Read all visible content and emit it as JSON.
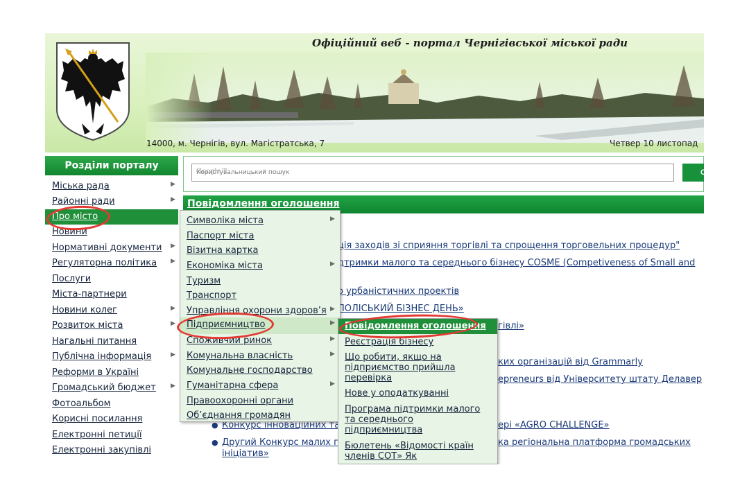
{
  "header": {
    "site_title": "Офіційний веб - портал Чернігівської міської ради",
    "address": "14000, м. Чернігів, вул. Магістратська, 7",
    "date": "Четвер 10 листопад"
  },
  "sidebar": {
    "title": "Розділи порталу",
    "items": [
      {
        "label": "Міська рада",
        "has_submenu": true
      },
      {
        "label": "Районні ради",
        "has_submenu": true
      },
      {
        "label": "Про місто",
        "has_submenu": false,
        "active": true
      },
      {
        "label": "Новини",
        "has_submenu": false
      },
      {
        "label": "Нормативні документи",
        "has_submenu": true
      },
      {
        "label": "Регуляторна політика",
        "has_submenu": true
      },
      {
        "label": "Послуги",
        "has_submenu": false
      },
      {
        "label": "Міста-партнери",
        "has_submenu": false
      },
      {
        "label": "Новини колег",
        "has_submenu": true
      },
      {
        "label": "Розвиток міста",
        "has_submenu": true
      },
      {
        "label": "Нагальні питання",
        "has_submenu": false
      },
      {
        "label": "Публічна інформація",
        "has_submenu": true
      },
      {
        "label": "Реформи в Україні",
        "has_submenu": false
      },
      {
        "label": "Громадський бюджет",
        "has_submenu": true
      },
      {
        "label": "Фотоальбом",
        "has_submenu": false
      },
      {
        "label": "Корисні посилання",
        "has_submenu": false
      },
      {
        "label": "Електронні петиції",
        "has_submenu": false
      },
      {
        "label": "Електронні закупівлі",
        "has_submenu": false
      }
    ]
  },
  "search": {
    "brand": "Google™",
    "placeholder": "Користувальницький пошук",
    "button_label": "С"
  },
  "content": {
    "heading": "Повідомлення оголошення",
    "lines": [
      "ція заходів зі сприяння торгівлі та спрощення торговельних процедур\"",
      "дтримки малого та середнього бізнесу COSME (Competiveness of Small and",
      "о урбаністичних проектів",
      "ПОЛІСЬКИЙ БІЗНЕС ДЕНЬ»",
      "гівлі»",
      "ких організацій від Grammarly",
      "epreneurs від Університету штату Делавер",
      "ері «AGRO CHALLENGE»",
      "ка регіональна платформа громадських"
    ],
    "list_items": [
      "Конкурс інноваційних та",
      "Другий Конкурс малих г",
      "ініціатив»"
    ]
  },
  "submenu_level2": {
    "items": [
      {
        "label": "Символіка міста",
        "has_submenu": true
      },
      {
        "label": "Паспорт міста",
        "has_submenu": false
      },
      {
        "label": "Візитна картка",
        "has_submenu": false
      },
      {
        "label": "Економіка міста",
        "has_submenu": true
      },
      {
        "label": "Туризм",
        "has_submenu": false
      },
      {
        "label": "Транспорт",
        "has_submenu": false
      },
      {
        "label": "Управління охорони здоров’я",
        "has_submenu": true
      },
      {
        "label": "Підприємництво",
        "has_submenu": true,
        "highlighted": true
      },
      {
        "label": "Споживчий ринок",
        "has_submenu": true
      },
      {
        "label": "Комунальна власність",
        "has_submenu": true
      },
      {
        "label": "Комунальне господарство",
        "has_submenu": false
      },
      {
        "label": "Гуманітарна сфера",
        "has_submenu": true
      },
      {
        "label": "Правоохоронні органи",
        "has_submenu": false
      },
      {
        "label": "Об’єднання громадян",
        "has_submenu": false
      }
    ]
  },
  "submenu_level3": {
    "items": [
      {
        "label": "Повідомлення оголошення",
        "active": true
      },
      {
        "label": "Реєстрація бізнесу"
      },
      {
        "label": "Що робити, якщо на підприємство прийшла перевірка"
      },
      {
        "label": "Нове у оподаткуванні"
      },
      {
        "label": "Програма підтримки малого та середнього підприємництва"
      },
      {
        "label": "Бюлетень «Відомості країн членів СОТ» Як"
      }
    ]
  },
  "colors": {
    "accent_green": "#1f8f3a",
    "header_bg": "#d9f0bd",
    "menu_bg": "#e8f5e6",
    "link": "#14233b",
    "annotation_red": "#e23a32"
  },
  "icons": [
    "coat-of-arms-icon",
    "submenu-arrow-icon"
  ]
}
